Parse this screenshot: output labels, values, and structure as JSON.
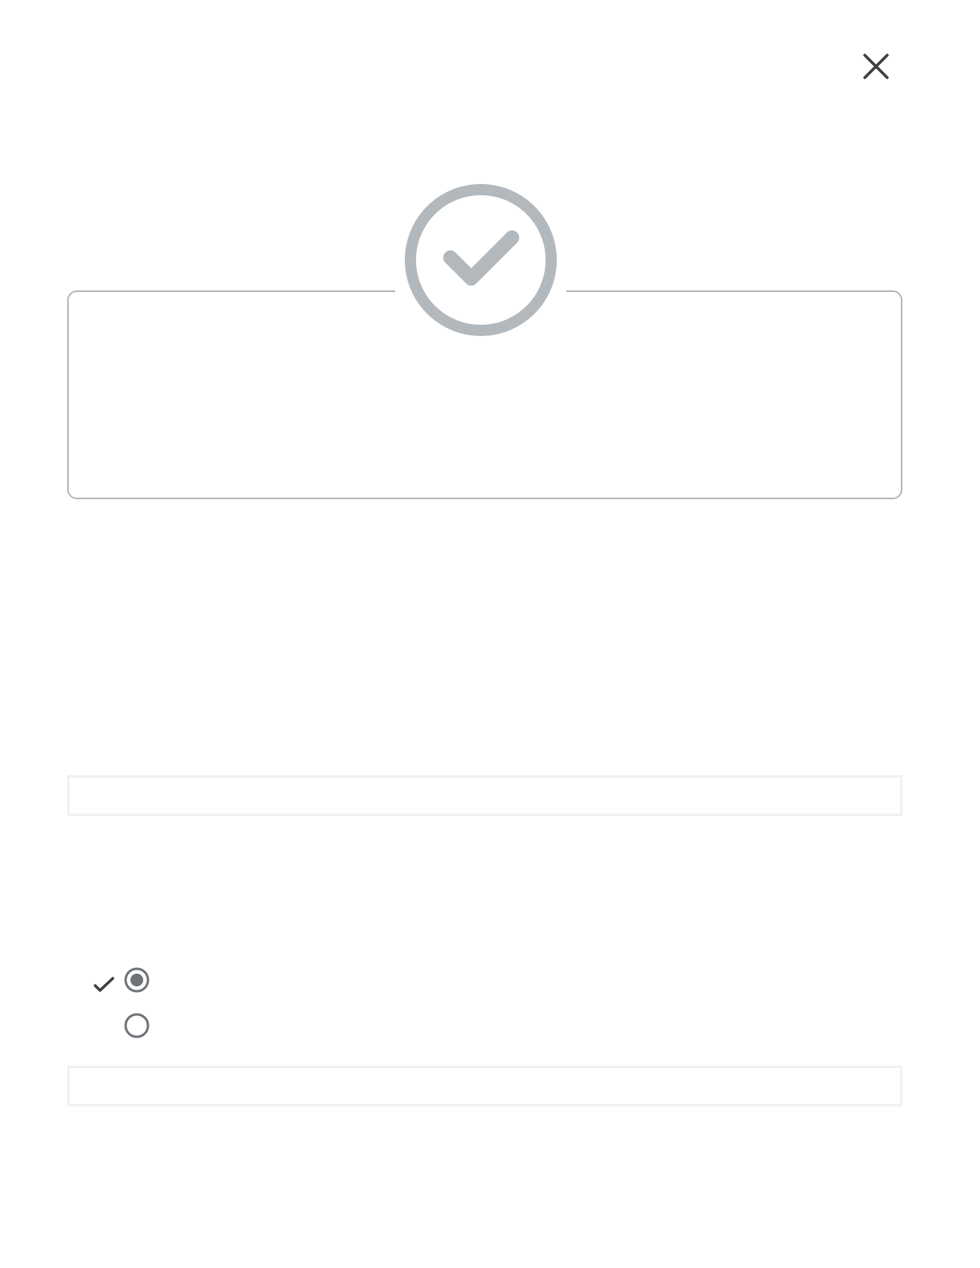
{
  "dialog": {
    "close_icon": "close-icon"
  },
  "result_card": {
    "badge_icon": "check-circle-icon",
    "badge_color": "#b3b8bd",
    "border_color": "#b3b8bd"
  },
  "options": [
    {
      "selected": true,
      "label": "",
      "check_icon": "check-icon"
    },
    {
      "selected": false,
      "label": ""
    }
  ],
  "colors": {
    "icon_dark": "#3c4043",
    "radio_ring": "#6f7479",
    "radio_dot": "#6f7479",
    "bar_border": "#eef1f5"
  }
}
